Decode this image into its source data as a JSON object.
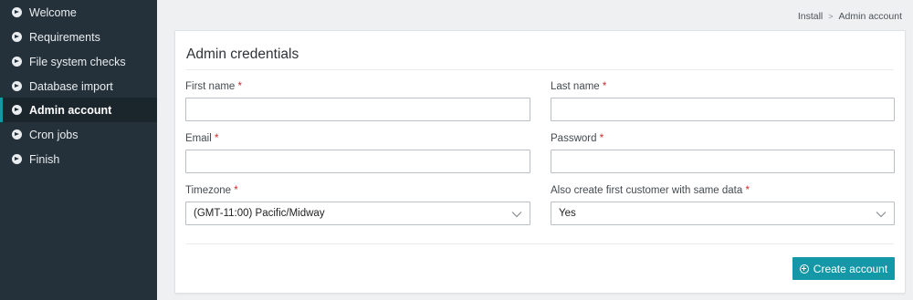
{
  "sidebar": {
    "items": [
      {
        "label": "Welcome",
        "icon": "arrow-circle-right-icon"
      },
      {
        "label": "Requirements",
        "icon": "arrow-circle-right-icon"
      },
      {
        "label": "File system checks",
        "icon": "arrow-circle-right-icon"
      },
      {
        "label": "Database import",
        "icon": "arrow-circle-right-icon"
      },
      {
        "label": "Admin account",
        "icon": "arrow-circle-right-icon",
        "active": true
      },
      {
        "label": "Cron jobs",
        "icon": "arrow-circle-right-icon"
      },
      {
        "label": "Finish",
        "icon": "arrow-circle-right-icon"
      }
    ]
  },
  "breadcrumb": {
    "root": "Install",
    "separator": ">",
    "current": "Admin account"
  },
  "form": {
    "title": "Admin credentials",
    "required_mark": "*",
    "first_name": {
      "label": "First name",
      "value": ""
    },
    "last_name": {
      "label": "Last name",
      "value": ""
    },
    "email": {
      "label": "Email",
      "value": ""
    },
    "password": {
      "label": "Password",
      "value": ""
    },
    "timezone": {
      "label": "Timezone",
      "value": "(GMT-11:00) Pacific/Midway"
    },
    "create_customer": {
      "label": "Also create first customer with same data",
      "value": "Yes"
    },
    "submit_label": "Create account"
  },
  "colors": {
    "sidebar_bg": "#25313a",
    "accent": "#1497a7",
    "required": "#cc2b2b"
  }
}
